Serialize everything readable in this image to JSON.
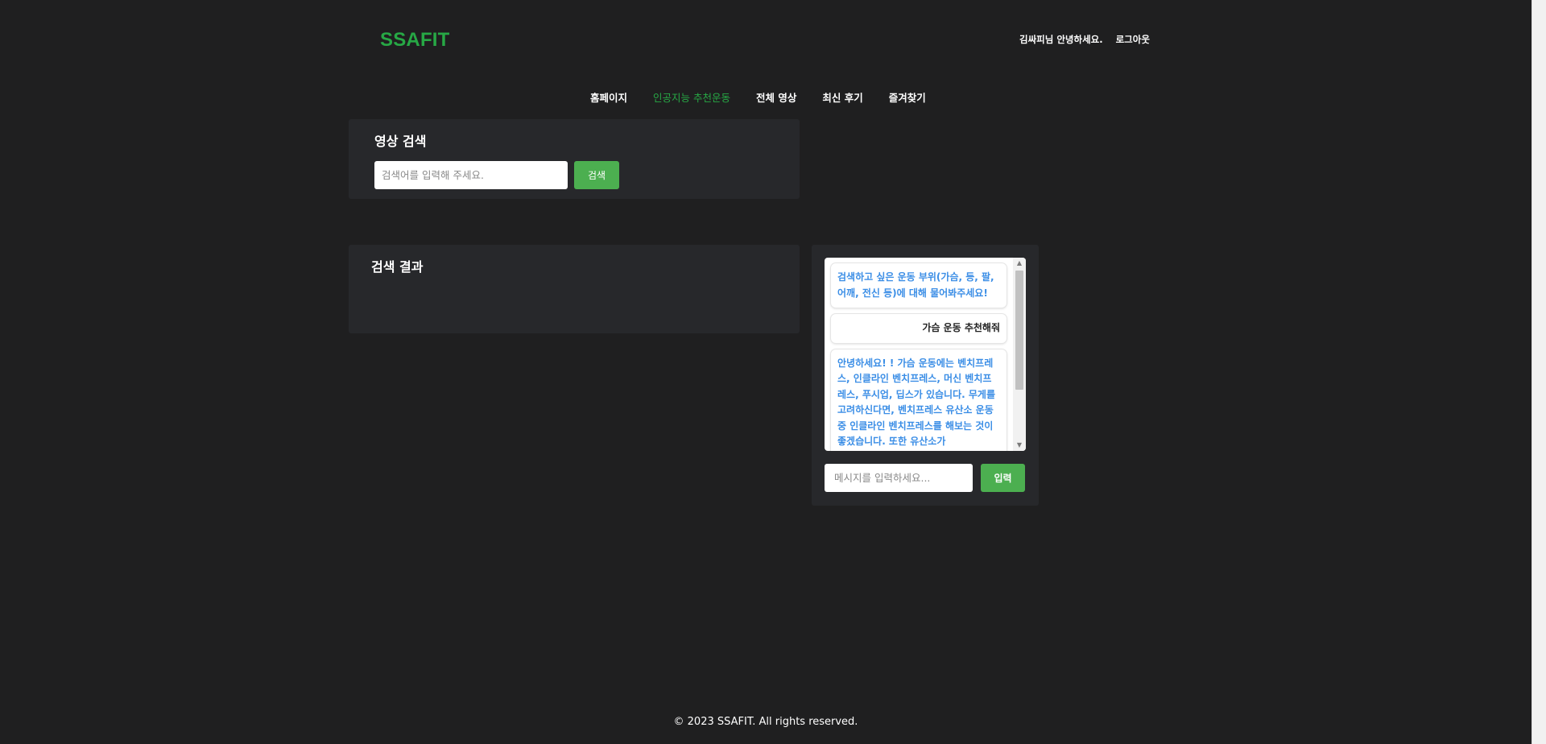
{
  "header": {
    "logo": "SSAFIT",
    "greeting": "김싸피님 안녕하세요.",
    "logout_label": "로그아웃"
  },
  "nav": {
    "items": [
      {
        "label": "홈페이지",
        "active": false
      },
      {
        "label": "인공지능 추천운동",
        "active": true
      },
      {
        "label": "전체 영상",
        "active": false
      },
      {
        "label": "최신 후기",
        "active": false
      },
      {
        "label": "즐겨찾기",
        "active": false
      }
    ]
  },
  "search": {
    "title": "영상 검색",
    "placeholder": "검색어를 입력해 주세요.",
    "button_label": "검색"
  },
  "results": {
    "title": "검색 결과"
  },
  "chat": {
    "messages": [
      {
        "sender": "bot",
        "text": "검색하고 싶은 운동 부위(가슴, 등, 팔, 어깨, 전신 등)에 대해 물어봐주세요!"
      },
      {
        "sender": "user",
        "text": "가슴 운동 추천해줘"
      },
      {
        "sender": "bot",
        "text": "안녕하세요! ! 가슴 운동에는 벤치프레스, 인클라인 벤치프레스, 머신 벤치프레스, 푸시업, 딥스가 있습니다. 무게를 고려하신다면, 벤치프레스 유산소 운동 중 인클라인 벤치프레스를 해보는 것이 좋겠습니다. 또한 유산소가"
      }
    ],
    "input_placeholder": "메시지를 입력하세요...",
    "send_label": "입력"
  },
  "footer": {
    "text": "© 2023 SSAFIT. All rights reserved."
  },
  "colors": {
    "background": "#1f1f20",
    "panel": "#27282b",
    "accent_green": "#27a845",
    "button_green": "#4caf50",
    "bot_text": "#3b8ee6"
  }
}
